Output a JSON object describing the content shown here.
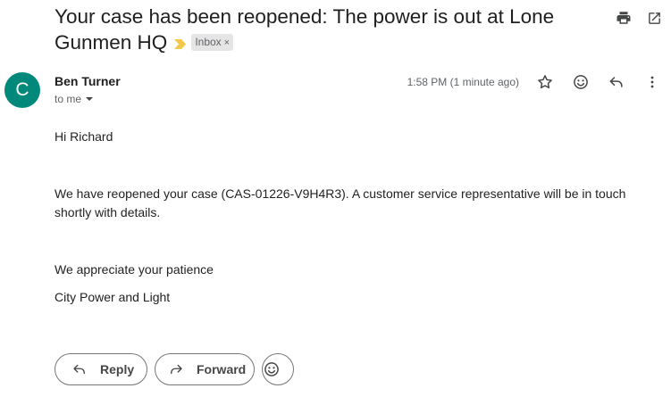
{
  "subject": "Your case has been reopened: The power is out at Lone Gunmen HQ",
  "label": "Inbox",
  "label_remove": "×",
  "icons": {
    "importance": "importance-marker-icon",
    "print": "print-icon",
    "popout": "open-in-new-window-icon",
    "star": "star-icon",
    "emoji": "emoji-reaction-icon",
    "reply": "reply-icon",
    "more": "more-vert-icon",
    "forward": "forward-icon"
  },
  "colors": {
    "avatar": "#00897b",
    "importance": "#f2c94c"
  },
  "message": {
    "avatar_letter": "C",
    "sender": "Ben Turner",
    "to": "to me",
    "time": "1:58 PM (1 minute ago)",
    "paragraphs": [
      "Hi Richard",
      "We have reopened your case (CAS-01226-V9H4R3). A customer service representative will be in touch shortly with details.",
      "We appreciate your patience",
      "City Power and Light"
    ]
  },
  "actions": {
    "reply": "Reply",
    "forward": "Forward"
  }
}
